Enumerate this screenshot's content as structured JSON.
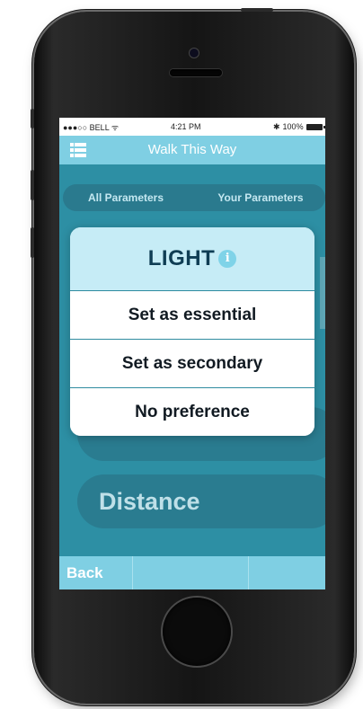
{
  "status_bar": {
    "carrier": "●●●○○ BELL ᯤ",
    "time": "4:21 PM",
    "battery_percent": "100%",
    "bluetooth_icon": "bluetooth-icon"
  },
  "nav": {
    "title": "Walk This Way",
    "menu_icon": "menu-list-icon"
  },
  "segments": {
    "all": "All Parameters",
    "yours": "Your Parameters"
  },
  "parameters": {
    "behind_label": "",
    "distance_label": "Distance"
  },
  "popup": {
    "title": "LIGHT",
    "info_icon": "i",
    "options": [
      "Set as essential",
      "Set as secondary",
      "No preference"
    ]
  },
  "bottom_bar": {
    "back_label": "Back"
  },
  "colors": {
    "accent": "#7fcfe3",
    "background": "#2d8fa4",
    "popup_header": "#c6ecf6",
    "text_dark": "#0f3d54"
  }
}
